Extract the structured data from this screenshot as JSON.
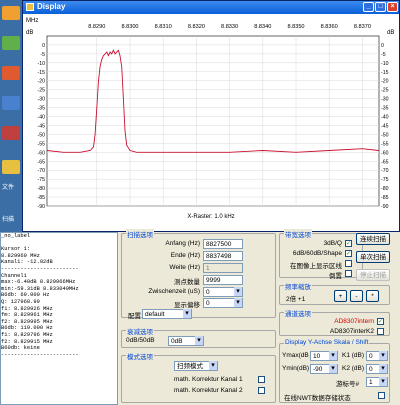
{
  "window": {
    "title": "Display",
    "minimize": "_",
    "maximize": "□",
    "close": "×"
  },
  "desktop": {
    "partial_labels": [
      "文件",
      "扫描"
    ]
  },
  "chart_data": {
    "type": "line",
    "title": "",
    "xlabel": "X-Raster: 1.0 kHz",
    "ylabel": "",
    "x_unit_label": "MHz",
    "y_unit_label": "dB",
    "xlim": [
      8.8275,
      8.8375
    ],
    "ylim": [
      -90,
      5
    ],
    "x_ticks": [
      "8.8290",
      "8.8300",
      "8.8310",
      "8.8320",
      "8.8330",
      "8.8340",
      "8.8350",
      "8.8360",
      "8.8370"
    ],
    "x_tick_values": [
      8.829,
      8.83,
      8.831,
      8.832,
      8.833,
      8.834,
      8.835,
      8.836,
      8.837
    ],
    "y_ticks": [
      "0",
      "-5",
      "-10",
      "-15",
      "-20",
      "-25",
      "-30",
      "-35",
      "-40",
      "-45",
      "-50",
      "-55",
      "-60",
      "-65",
      "-70",
      "-75",
      "-80",
      "-85",
      "-90"
    ],
    "y_tick_values": [
      0,
      -5,
      -10,
      -15,
      -20,
      -25,
      -30,
      -35,
      -40,
      -45,
      -50,
      -55,
      -60,
      -65,
      -70,
      -75,
      -80,
      -85,
      -90
    ],
    "series": [
      {
        "color": "#c8102e",
        "x": [
          8.8275,
          8.828,
          8.8285,
          8.8288,
          8.8289,
          8.82895,
          8.829,
          8.82905,
          8.8291,
          8.82915,
          8.8292,
          8.82925,
          8.8293,
          8.82935,
          8.8294,
          8.82945,
          8.8295,
          8.82955,
          8.8296,
          8.82965,
          8.8297,
          8.82975,
          8.8298,
          8.82985,
          8.8299,
          8.83,
          8.8302,
          8.8305,
          8.831,
          8.832,
          8.833,
          8.834,
          8.835,
          8.836,
          8.837,
          8.8375
        ],
        "y": [
          -59,
          -60,
          -60,
          -59,
          -57,
          -50,
          -35,
          -20,
          -12,
          -8,
          -6,
          -5,
          -4,
          -6,
          -4,
          -5,
          -3,
          -5,
          -4,
          -3,
          -6,
          -12,
          -30,
          -48,
          -56,
          -59,
          -60,
          -60,
          -60,
          -60,
          -60,
          -59,
          -60,
          -59,
          -58,
          -59
        ]
      }
    ],
    "grid": true
  },
  "log": [
    "_no_label",
    "",
    "Kursor 1:",
    "8.829960 MHz",
    "Kanal1: -12.02dB",
    "------------------------",
    "Channel1",
    "max:-6.40dB 8.829966MHz",
    "min:-59.31dB 8.833049MHz",
    "B6db: 69.000 Hz",
    "Q: 127960.99",
    "f1: 8.829926 MHz",
    "fm: 8.829961 MHz",
    "f2: 8.829995 MHz",
    "B6db: 119.000 Hz",
    "f1: 8.829796 MHz",
    "f2: 8.829915 MHz",
    "B60db: keine",
    "------------------------"
  ],
  "sweep": {
    "title": "扫描选项",
    "start_label": "Anfang (Hz)",
    "start_value": "8827500",
    "end_label": "Ende (Hz)",
    "end_value": "8837498",
    "width_label": "Weite (Hz)",
    "width_value": "1",
    "points_label": "测点数量",
    "points_value": "9999",
    "interval_label": "Zwischenzeit (uS)",
    "interval_value": "0",
    "offset_label": "显示偏移",
    "offset_value": "0",
    "config_label": "配置",
    "config_value": "default"
  },
  "attenuation": {
    "title": "衰减选项",
    "value1": "0dB/50dB",
    "value2": "0dB"
  },
  "mode": {
    "title": "模式选项",
    "mode_value": "扫频模式",
    "korr1_label": "math. Korrektur Kanal 1",
    "korr2_label": "math. Korrektur Kanal 2"
  },
  "freq_opts": {
    "title": "带宽选项",
    "opt1": "3dB/Q",
    "opt2": "6dB/60dB/Shape",
    "opt3": "在图像上显示区线",
    "opt4": "倒置",
    "btn_continuous": "连续扫描",
    "btn_single": "单次扫描",
    "btn_stop": "停止扫描"
  },
  "zoom": {
    "title": "频率缩放",
    "factor_label": "2倍 +1",
    "plus": "+",
    "minus": "-",
    "star": "*"
  },
  "channel": {
    "title": "通道选项",
    "ch1": "AD8307intern",
    "ch2": "AD8307interK2"
  },
  "display": {
    "title": "Display Y-Achse  Skala / Shift",
    "ymax_label": "Ymax(dB",
    "ymax_value": "10",
    "ymin_label": "Ymin(dB)",
    "ymin_value": "-90",
    "k1_label": "K1 (dB)",
    "k1_value": "0",
    "k2_label": "K2 (dB)",
    "k2_value": "0",
    "marker_label": "游标号#",
    "marker_value": "1",
    "save_label": "在线NWT数据存储状态"
  }
}
